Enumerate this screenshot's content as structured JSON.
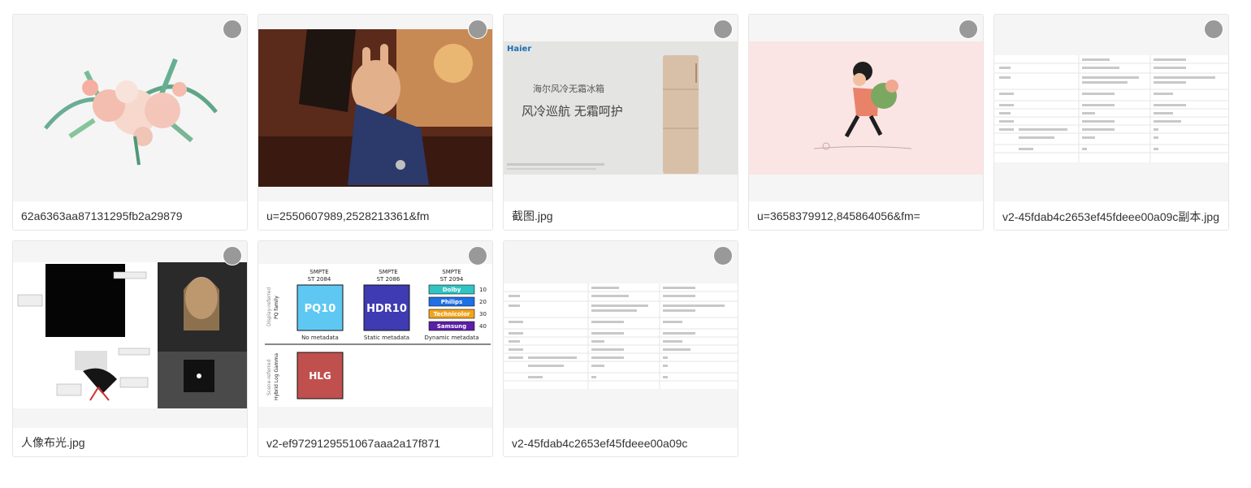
{
  "files": [
    {
      "name": "62a6363aa87131295fb2a29879",
      "icon": "watercolor-flowers-image"
    },
    {
      "name": "u=2550607989,2528213361&fm",
      "icon": "photo-hand-gesture-image"
    },
    {
      "name": "截图.jpg",
      "icon": "haier-fridge-ad-image",
      "brand": "Haier",
      "headline1": "海尔风冷无霜冰箱",
      "headline2": "风冷巡航 无霜呵护"
    },
    {
      "name": "u=3658379912,845864056&fm=",
      "icon": "illustration-girl-flowers-image"
    },
    {
      "name": "v2-45fdab4c2653ef45fdeee00a09c副本.jpg",
      "icon": "comparison-table-image"
    },
    {
      "name": "人像布光.jpg",
      "icon": "portrait-lighting-setup-image"
    },
    {
      "name": "v2-ef9729129551067aaa2a17f871",
      "icon": "hdr-format-diagram-image",
      "hdr": {
        "standards": [
          "SMPTE\nST 2084",
          "SMPTE\nST 2086",
          "SMPTE\nST 2094"
        ],
        "pq10": "PQ10",
        "hdr10": "HDR10",
        "hlg": "HLG",
        "meta": [
          "No metadata",
          "Static metadata",
          "Dynamic metadata"
        ],
        "vendors": [
          "Dolby",
          "Philips",
          "Technicolor",
          "Samsung"
        ],
        "vendor_nums": [
          "10",
          "20",
          "30",
          "40"
        ],
        "side_top": "Display-referred",
        "side_top2": "PQ family",
        "side_bot": "Scene-referred",
        "side_bot2": "Hybrid Log Gamma"
      }
    },
    {
      "name": "v2-45fdab4c2653ef45fdeee00a09c",
      "icon": "comparison-table-image"
    }
  ],
  "colors": {
    "select": "#999999",
    "pq10": "#5ec8f2",
    "hdr10": "#3f3bb3",
    "hlg": "#c0504d",
    "dolby": "#31c4c4",
    "philips": "#1f6fe5",
    "technicolor": "#f2a51b",
    "samsung": "#5b1fa8"
  }
}
